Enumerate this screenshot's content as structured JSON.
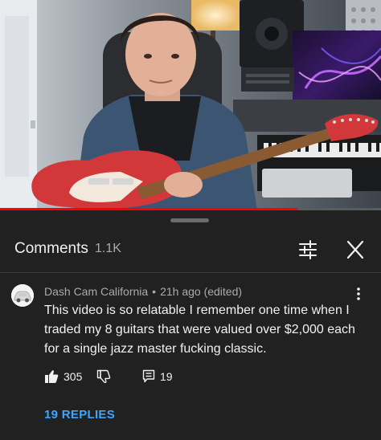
{
  "video": {
    "progress_fraction": 0.78
  },
  "comments_panel": {
    "title": "Comments",
    "count": "1.1K",
    "filter_icon": "sliders-icon",
    "close_icon": "close-icon"
  },
  "comment": {
    "author": "Dash Cam California",
    "separator": "•",
    "time": "21h ago (edited)",
    "text": "This video is so relatable I remember one time when I traded my 8 guitars that were valued over $2,000 each for a single jazz master fucking classic.",
    "likes": "305",
    "replies_count": "19",
    "replies_link": "19 REPLIES",
    "icons": {
      "avatar": "car-avatar",
      "like": "thumbs-up-icon",
      "dislike": "thumbs-down-icon",
      "reply": "reply-icon",
      "more": "more-vert-icon"
    }
  },
  "colors": {
    "background": "#212121",
    "text": "#f1f1f1",
    "secondary_text": "#aaaaaa",
    "link": "#3ea6ff",
    "progress": "#ff0000"
  }
}
